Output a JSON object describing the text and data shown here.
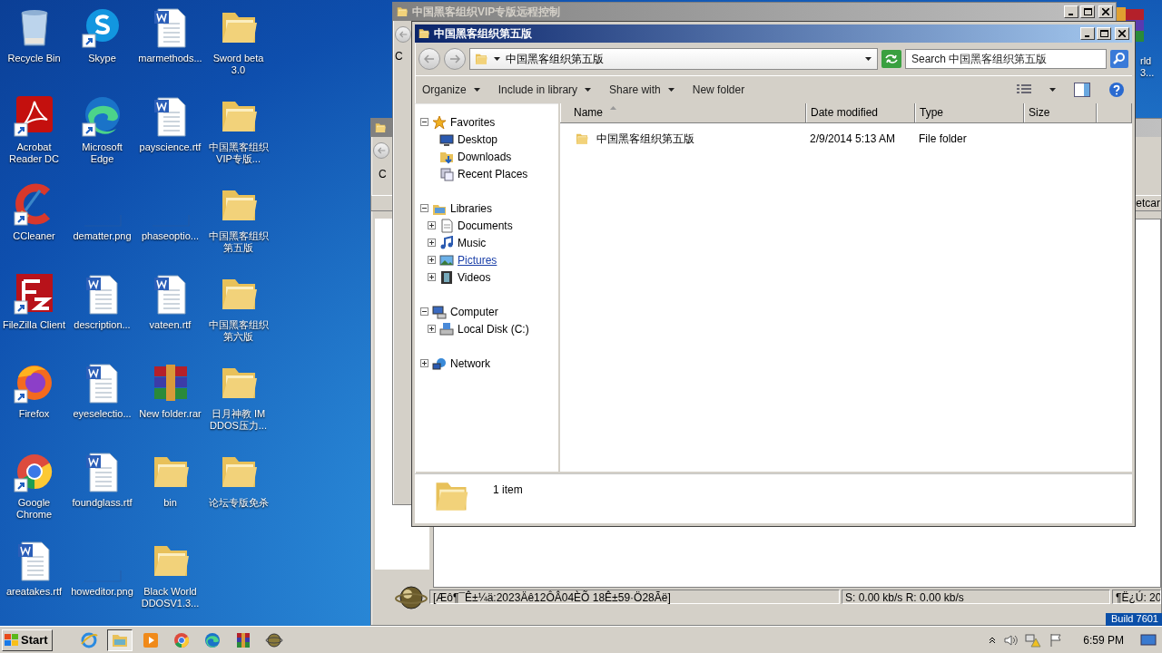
{
  "desktop": {
    "icons": [
      {
        "label": "Recycle Bin",
        "kind": "recycle-bin",
        "shortcut": false
      },
      {
        "label": "Skype",
        "kind": "skype",
        "shortcut": true
      },
      {
        "label": "marmethods...",
        "kind": "word",
        "shortcut": false
      },
      {
        "label": "Sword beta 3.0",
        "kind": "folder",
        "shortcut": false
      },
      {
        "label": "Acrobat Reader DC",
        "kind": "acrobat",
        "shortcut": true
      },
      {
        "label": "Microsoft Edge",
        "kind": "edge",
        "shortcut": true
      },
      {
        "label": "payscience.rtf",
        "kind": "word",
        "shortcut": false
      },
      {
        "label": "中国黑客组织VIP专版...",
        "kind": "folder",
        "shortcut": false
      },
      {
        "label": "CCleaner",
        "kind": "ccleaner",
        "shortcut": true
      },
      {
        "label": "dematter.png",
        "kind": "image",
        "shortcut": false
      },
      {
        "label": "phaseoptio...",
        "kind": "image",
        "shortcut": false
      },
      {
        "label": "中国黑客组织第五版",
        "kind": "folder",
        "shortcut": false
      },
      {
        "label": "FileZilla Client",
        "kind": "filezilla",
        "shortcut": true
      },
      {
        "label": "description...",
        "kind": "word",
        "shortcut": false
      },
      {
        "label": "vateen.rtf",
        "kind": "word",
        "shortcut": false
      },
      {
        "label": "中国黑客组织第六版",
        "kind": "folder",
        "shortcut": false
      },
      {
        "label": "Firefox",
        "kind": "firefox",
        "shortcut": true
      },
      {
        "label": "eyeselectio...",
        "kind": "word",
        "shortcut": false
      },
      {
        "label": "New folder.rar",
        "kind": "archive",
        "shortcut": false
      },
      {
        "label": "日月神教 IM DDOS压力...",
        "kind": "folder",
        "shortcut": false
      },
      {
        "label": "Google Chrome",
        "kind": "chrome",
        "shortcut": true
      },
      {
        "label": "foundglass.rtf",
        "kind": "word",
        "shortcut": false
      },
      {
        "label": "bin",
        "kind": "folder",
        "shortcut": false
      },
      {
        "label": "论坛专版免杀",
        "kind": "folder",
        "shortcut": false
      },
      {
        "label": "areatakes.rtf",
        "kind": "word",
        "shortcut": false
      },
      {
        "label": "howeditor.png",
        "kind": "image",
        "shortcut": false
      },
      {
        "label": "Black World DDOSV1.3...",
        "kind": "folder",
        "shortcut": false
      }
    ],
    "partial_label": "rld 3...",
    "build": "Build 7601"
  },
  "lower_window": {
    "letter": "C",
    "column": "etcar",
    "status_bar": [
      "[Æô¶¯Ê±¼ä:2023Äê12ÔÂ04ÈÕ 18Ê±59·Ö28Ãë]",
      "S: 0.00 kb/s R: 0.00 kb/s",
      "¶Ë¿Ú: 20"
    ]
  },
  "back_window": {
    "title": "中国黑客组织VIP专版远程控制",
    "letter": "C"
  },
  "explorer": {
    "title": "中国黑客组织第五版",
    "address": "中国黑客组织第五版",
    "search": {
      "placeholder": "Search 中国黑客组织第五版"
    },
    "toolbar": [
      {
        "label": "Organize",
        "dropdown": true
      },
      {
        "label": "Include in library",
        "dropdown": true
      },
      {
        "label": "Share with",
        "dropdown": true
      },
      {
        "label": "New folder",
        "dropdown": false
      }
    ],
    "tree": [
      {
        "label": "Favorites",
        "kind": "favorites",
        "expanded": true,
        "hovered": false,
        "children": [
          {
            "label": "Desktop",
            "kind": "desktop",
            "hovered": false
          },
          {
            "label": "Downloads",
            "kind": "downloads",
            "hovered": false
          },
          {
            "label": "Recent Places",
            "kind": "recent",
            "hovered": false
          }
        ]
      },
      {
        "label": "Libraries",
        "kind": "libraries",
        "expanded": true,
        "hovered": false,
        "children": [
          {
            "label": "Documents",
            "kind": "documents",
            "expanded": false,
            "hovered": false
          },
          {
            "label": "Music",
            "kind": "music",
            "expanded": false,
            "hovered": false
          },
          {
            "label": "Pictures",
            "kind": "pictures",
            "expanded": false,
            "hovered": true
          },
          {
            "label": "Videos",
            "kind": "videos",
            "expanded": false,
            "hovered": false
          }
        ]
      },
      {
        "label": "Computer",
        "kind": "computer",
        "expanded": true,
        "hovered": false,
        "children": [
          {
            "label": "Local Disk (C:)",
            "kind": "disk",
            "expanded": false,
            "hovered": false
          }
        ]
      },
      {
        "label": "Network",
        "kind": "network",
        "expanded": false,
        "hovered": false
      }
    ],
    "columns": [
      {
        "label": "Name",
        "sorted": true
      },
      {
        "label": "Date modified",
        "sorted": false
      },
      {
        "label": "Type",
        "sorted": false
      },
      {
        "label": "Size",
        "sorted": false
      }
    ],
    "rows": [
      {
        "name": "中国黑客组织第五版",
        "date": "2/9/2014 5:13 AM",
        "type": "File folder"
      }
    ],
    "details": "1 item"
  },
  "taskbar": {
    "start": "Start",
    "apps": [
      {
        "kind": "ie",
        "active": false
      },
      {
        "kind": "explorer",
        "active": true
      },
      {
        "kind": "media",
        "active": false
      },
      {
        "kind": "chrome",
        "active": false
      },
      {
        "kind": "edge",
        "active": false
      },
      {
        "kind": "archive",
        "active": false
      },
      {
        "kind": "globe",
        "active": false
      }
    ],
    "clock": "6:59 PM"
  }
}
